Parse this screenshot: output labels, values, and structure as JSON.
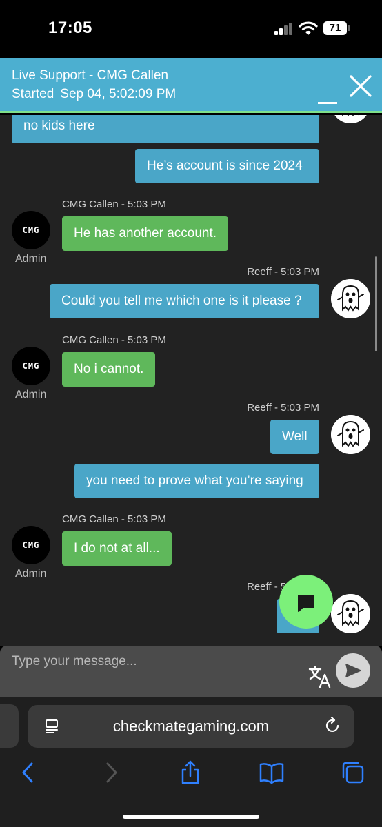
{
  "status_bar": {
    "time": "17:05",
    "battery": "71"
  },
  "chat_header": {
    "title": "Live Support - CMG Callen",
    "started_label": "Started",
    "started_value": "Sep 04, 5:02:09 PM"
  },
  "messages": [
    {
      "text": "no kids here"
    },
    {
      "text": "He’s account is since 2024"
    },
    {
      "meta": "CMG Callen - 5:03 PM",
      "text": "He has another account.",
      "role": "Admin",
      "avatar": "CMG"
    },
    {
      "meta": "Reeff - 5:03 PM",
      "text": "Could you tell me which one is it please ?"
    },
    {
      "meta": "CMG Callen - 5:03 PM",
      "text": "No i cannot.",
      "role": "Admin",
      "avatar": "CMG"
    },
    {
      "meta": "Reeff - 5:03 PM",
      "text": "Well"
    },
    {
      "text": "you need to prove what you’re saying"
    },
    {
      "meta": "CMG Callen - 5:03 PM",
      "text": "I do not at all...",
      "role": "Admin",
      "avatar": "CMG"
    },
    {
      "meta": "Reeff - 5"
    }
  ],
  "input": {
    "placeholder": "Type your message..."
  },
  "browser": {
    "url": "checkmategaming.com"
  },
  "colors": {
    "header": "#4cafd0",
    "agent_bubble": "#5fb85b",
    "user_bubble": "#4aa6c8",
    "fab": "#7cf07a",
    "chat_background": "#222222"
  },
  "icons": [
    "signal-icon",
    "wifi-icon",
    "battery-icon",
    "minimize-icon",
    "close-icon",
    "ghost-avatar-icon",
    "chat-bubble-icon",
    "translate-icon",
    "send-icon",
    "reader-icon",
    "reload-icon",
    "back-icon",
    "forward-icon",
    "share-icon",
    "bookmarks-icon",
    "tabs-icon"
  ]
}
